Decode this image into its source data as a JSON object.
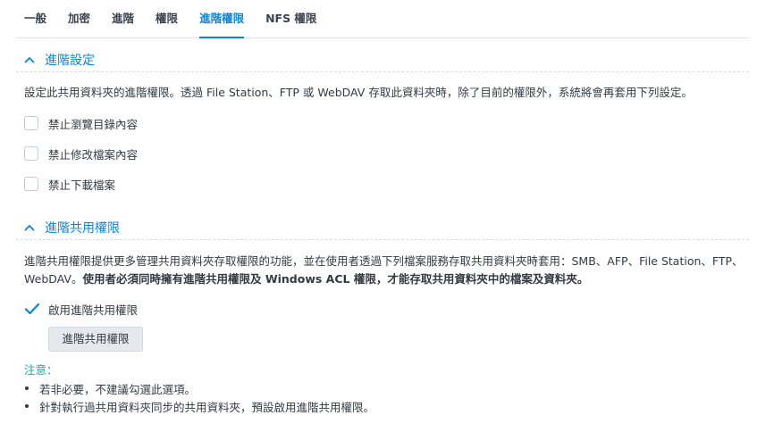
{
  "tabs": {
    "items": [
      {
        "label": "一般"
      },
      {
        "label": "加密"
      },
      {
        "label": "進階"
      },
      {
        "label": "權限"
      },
      {
        "label": "進階權限"
      },
      {
        "label": "NFS 權限"
      }
    ],
    "active_index": 4
  },
  "section_advanced": {
    "title": "進階設定",
    "description": "設定此共用資料夾的進階權限。透過 File Station、FTP 或 WebDAV 存取此資料夾時，除了目前的權限外，系統將會再套用下列設定。",
    "options": [
      {
        "label": "禁止瀏覽目錄內容",
        "checked": false
      },
      {
        "label": "禁止修改檔案內容",
        "checked": false
      },
      {
        "label": "禁止下載檔案",
        "checked": false
      }
    ]
  },
  "section_share_perm": {
    "title": "進階共用權限",
    "description_normal": "進階共用權限提供更多管理共用資料夾存取權限的功能，並在使用者透過下列檔案服務存取共用資料夾時套用：SMB、AFP、File Station、FTP、WebDAV。",
    "description_bold": "使用者必須同時擁有進階共用權限及 Windows ACL 權限，才能存取共用資料夾中的檔案及資料夾。",
    "enable_option": {
      "label": "啟用進階共用權限",
      "checked": true
    },
    "button_label": "進階共用權限"
  },
  "note": {
    "title": "注意：",
    "items": [
      "若非必要，不建議勾選此選項。",
      "針對執行過共用資料夾同步的共用資料夾，預設啟用進階共用權限。"
    ]
  },
  "colors": {
    "accent": "#0c86d6",
    "note": "#19a8a0"
  }
}
